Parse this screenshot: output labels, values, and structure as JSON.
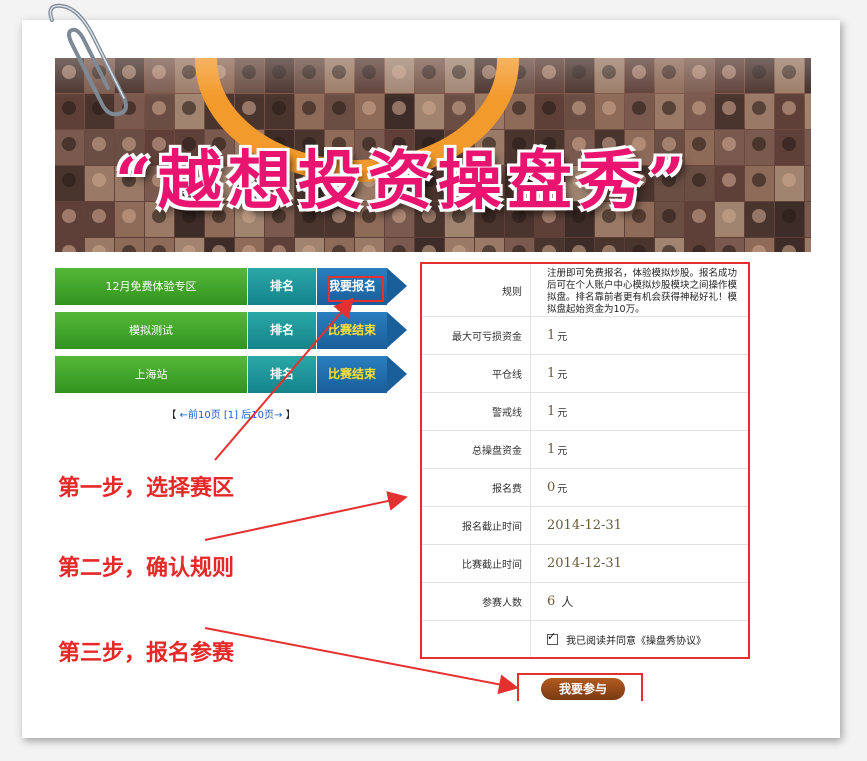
{
  "banner": {
    "title": "“越想投资操盘秀”"
  },
  "zones": [
    {
      "name": "12月免费体验专区",
      "rank_label": "排名",
      "action_label": "我要报名",
      "action_state": "open"
    },
    {
      "name": "模拟测试",
      "rank_label": "排名",
      "action_label": "比赛结束",
      "action_state": "ended"
    },
    {
      "name": "上海站",
      "rank_label": "排名",
      "action_label": "比赛结束",
      "action_state": "ended"
    }
  ],
  "pager": {
    "open": "【",
    "prev": "←前10页",
    "current": "[1]",
    "next": "后10页→",
    "close": "】"
  },
  "steps": {
    "step1": "第一步，选择赛区",
    "step2": "第二步，确认规则",
    "step3": "第三步，报名参赛"
  },
  "rules": {
    "rows": [
      {
        "label": "规则",
        "value": "注册即可免费报名，体验模拟炒股。报名成功后可在个人账户中心模拟炒股模块之间操作模拟盘。排名靠前者更有机会获得神秘好礼！模拟盘起始资金为10万。"
      },
      {
        "label": "最大可亏损资金",
        "value": "1",
        "unit": "元"
      },
      {
        "label": "平仓线",
        "value": "1",
        "unit": "元"
      },
      {
        "label": "警戒线",
        "value": "1",
        "unit": "元"
      },
      {
        "label": "总操盘资金",
        "value": "1",
        "unit": "元"
      },
      {
        "label": "报名费",
        "value": "0",
        "unit": "元"
      },
      {
        "label": "报名截止时间",
        "value": "2014-12-31"
      },
      {
        "label": "比赛截止时间",
        "value": "2014-12-31"
      },
      {
        "label": "参赛人数",
        "value": "6",
        "unit": "人"
      }
    ],
    "agree_text": "我已阅读并同意《操盘秀协议》",
    "agree_checked": true
  },
  "join_button": "我要参与",
  "colors": {
    "annotation_red": "#e53030",
    "zone_green": "#3fa528",
    "rank_teal": "#14848a",
    "action_blue": "#1a5e9a",
    "ended_yellow": "#ffe033",
    "join_brown": "#8a4316"
  }
}
